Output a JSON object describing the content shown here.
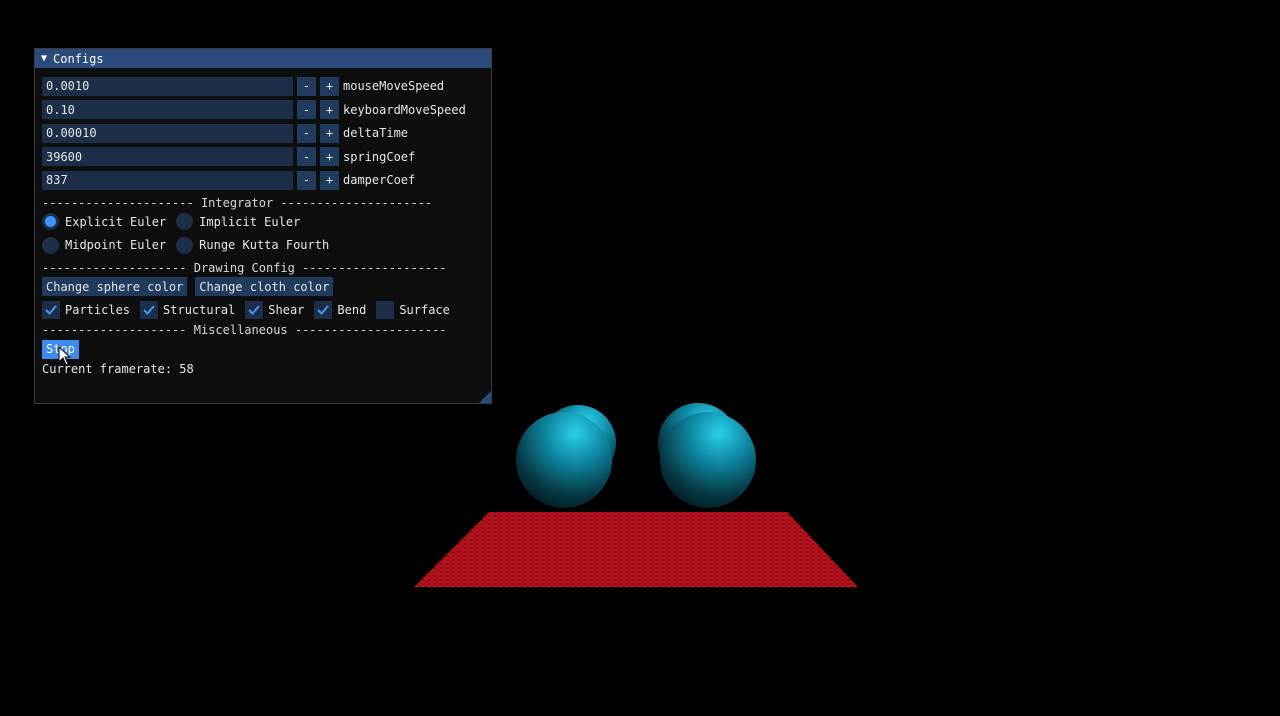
{
  "window": {
    "title": "Configs"
  },
  "fields": [
    {
      "value": "0.0010",
      "label": "mouseMoveSpeed"
    },
    {
      "value": "0.10",
      "label": "keyboardMoveSpeed"
    },
    {
      "value": "0.00010",
      "label": "deltaTime"
    },
    {
      "value": "39600",
      "label": "springCoef"
    },
    {
      "value": "837",
      "label": "damperCoef"
    }
  ],
  "stepper": {
    "minus": "-",
    "plus": "+"
  },
  "separators": {
    "integrator": "--------------------- Integrator ---------------------",
    "drawing": "-------------------- Drawing Config --------------------",
    "misc": "-------------------- Miscellaneous ---------------------"
  },
  "integrator": {
    "options": [
      "Explicit Euler",
      "Implicit Euler",
      "Midpoint Euler",
      "Runge Kutta Fourth"
    ],
    "selected": "Explicit Euler"
  },
  "drawing": {
    "sphere_button": "Change sphere color",
    "cloth_button": "Change cloth color",
    "checkboxes": [
      {
        "label": "Particles",
        "checked": true
      },
      {
        "label": "Structural",
        "checked": true
      },
      {
        "label": "Shear",
        "checked": true
      },
      {
        "label": "Bend",
        "checked": true
      },
      {
        "label": "Surface",
        "checked": false
      }
    ]
  },
  "misc": {
    "stop_button": "Stop",
    "framerate_label": "Current framerate: 58"
  },
  "colors": {
    "title_bar": "#294a7a",
    "frame_bg": "#1d2f48",
    "button": "#213b5e",
    "accent": "#4296fa",
    "sphere": "#19b4d2",
    "cloth": "#c8101e"
  }
}
